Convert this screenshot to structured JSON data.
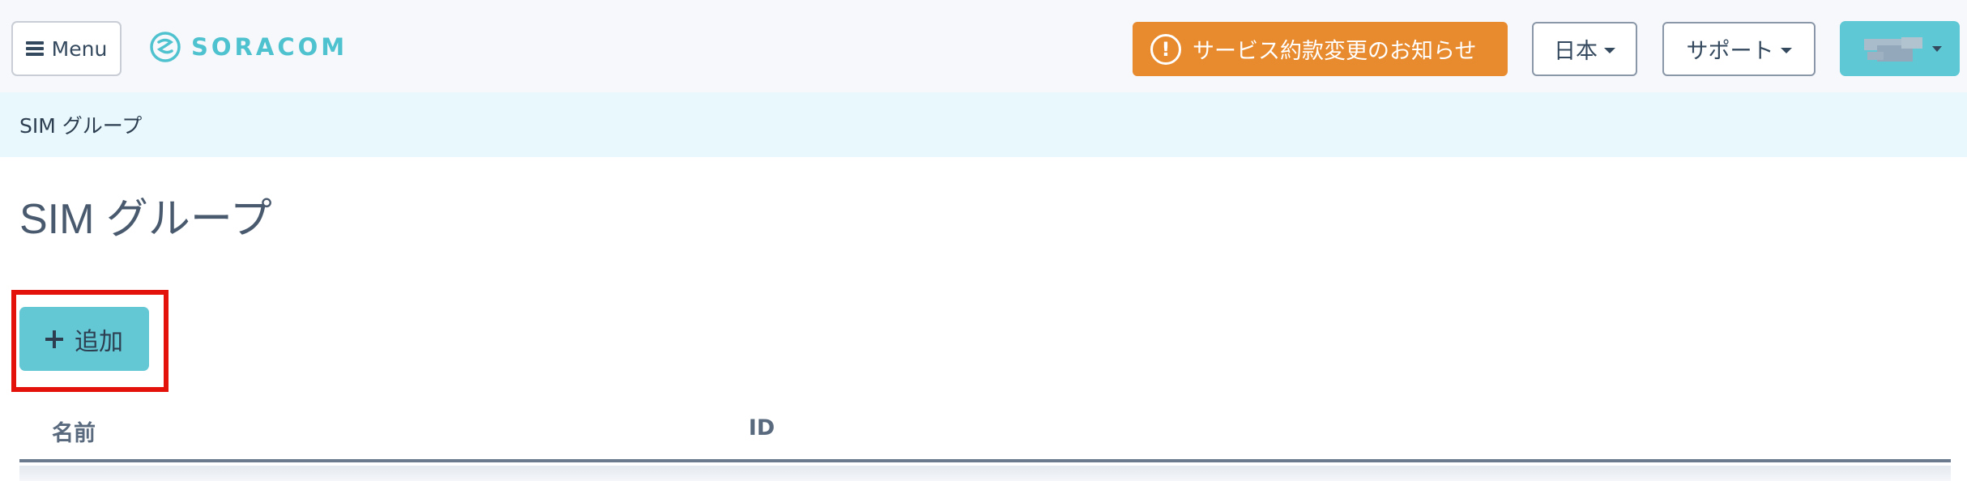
{
  "navbar": {
    "menu_label": "Menu",
    "logo_text": "SORACOM",
    "notice_label": "サービス約款変更のお知らせ",
    "language_label": "日本",
    "support_label": "サポート",
    "account_label": ""
  },
  "breadcrumb": {
    "current": "SIM グループ"
  },
  "page": {
    "title": "SIM グループ",
    "add_button_label": "追加"
  },
  "table": {
    "columns": [
      "名前",
      "ID"
    ],
    "rows": []
  },
  "colors": {
    "brand": "#4fc2cf",
    "notice": "#e88a2e",
    "primary_button": "#63c7d4",
    "breadcrumb_bg": "#e9f8fc",
    "highlight": "#e3120b"
  },
  "icons": {
    "menu": "hamburger-icon",
    "logo": "soracom-logo-icon",
    "notice": "alert-circle-icon",
    "add": "plus-icon",
    "dropdown": "caret-down-icon"
  }
}
